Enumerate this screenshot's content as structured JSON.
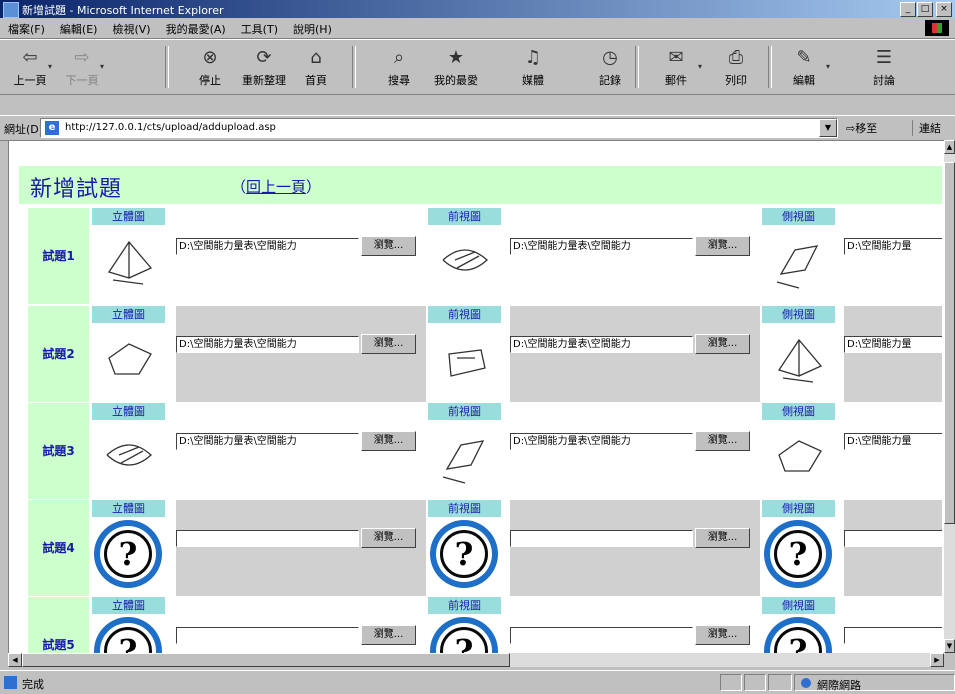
{
  "window": {
    "title": "新增試題 - Microsoft Internet Explorer",
    "controls": [
      "_",
      "□",
      "×"
    ]
  },
  "menu": [
    "檔案(F)",
    "編輯(E)",
    "檢視(V)",
    "我的最愛(A)",
    "工具(T)",
    "說明(H)"
  ],
  "toolbar": [
    {
      "label": "上一頁",
      "icon": "back-arrow-icon",
      "glyph": "⇦",
      "enabled": true,
      "dropdown": true
    },
    {
      "label": "下一頁",
      "icon": "forward-arrow-icon",
      "glyph": "⇨",
      "enabled": false,
      "dropdown": true
    },
    {
      "label": "停止",
      "icon": "stop-icon",
      "glyph": "⊗",
      "enabled": true,
      "dropdown": false
    },
    {
      "label": "重新整理",
      "icon": "refresh-icon",
      "glyph": "⟳",
      "enabled": true,
      "dropdown": false
    },
    {
      "label": "首頁",
      "icon": "home-icon",
      "glyph": "⌂",
      "enabled": true,
      "dropdown": false
    },
    {
      "label": "搜尋",
      "icon": "search-icon",
      "glyph": "⌕",
      "enabled": true,
      "dropdown": false
    },
    {
      "label": "我的最愛",
      "icon": "favorites-icon",
      "glyph": "★",
      "enabled": true,
      "dropdown": false
    },
    {
      "label": "媒體",
      "icon": "media-icon",
      "glyph": "♫",
      "enabled": true,
      "dropdown": false
    },
    {
      "label": "記錄",
      "icon": "history-icon",
      "glyph": "◷",
      "enabled": true,
      "dropdown": false
    },
    {
      "label": "郵件",
      "icon": "mail-icon",
      "glyph": "✉",
      "enabled": true,
      "dropdown": true
    },
    {
      "label": "列印",
      "icon": "print-icon",
      "glyph": "⎙",
      "enabled": true,
      "dropdown": false
    },
    {
      "label": "編輯",
      "icon": "edit-icon",
      "glyph": "✎",
      "enabled": true,
      "dropdown": true
    },
    {
      "label": "討論",
      "icon": "discuss-icon",
      "glyph": "☰",
      "enabled": true,
      "dropdown": false
    }
  ],
  "address": {
    "label": "網址(D)",
    "url": "http://127.0.0.1/cts/upload/addupload.asp",
    "go_label": "移至",
    "links_label": "連結"
  },
  "page": {
    "title": "新增試題",
    "back_link": {
      "open": "（",
      "text": "回上一頁",
      "close": "）"
    },
    "view_labels": [
      "立體圖",
      "前視圖",
      "側視圖"
    ],
    "browse_label": "瀏覽...",
    "rows": [
      {
        "label": "試題1",
        "files": [
          "D:\\空間能力量表\\空間能力",
          "D:\\空間能力量表\\空間能力",
          "D:\\空間能力量"
        ],
        "images": [
          "sketch",
          "sketch",
          "sketch"
        ]
      },
      {
        "label": "試題2",
        "files": [
          "D:\\空間能力量表\\空間能力",
          "D:\\空間能力量表\\空間能力",
          "D:\\空間能力量"
        ],
        "images": [
          "sketch",
          "sketch",
          "sketch"
        ]
      },
      {
        "label": "試題3",
        "files": [
          "D:\\空間能力量表\\空間能力",
          "D:\\空間能力量表\\空間能力",
          "D:\\空間能力量"
        ],
        "images": [
          "sketch",
          "sketch",
          "sketch"
        ]
      },
      {
        "label": "試題4",
        "files": [
          "",
          "",
          ""
        ],
        "images": [
          "question-mark",
          "question-mark",
          "question-mark"
        ]
      },
      {
        "label": "試題5",
        "files": [
          "",
          "",
          ""
        ],
        "images": [
          "question-mark",
          "question-mark",
          "question-mark"
        ]
      }
    ]
  },
  "status": {
    "text": "完成",
    "zone": "網際網路"
  }
}
